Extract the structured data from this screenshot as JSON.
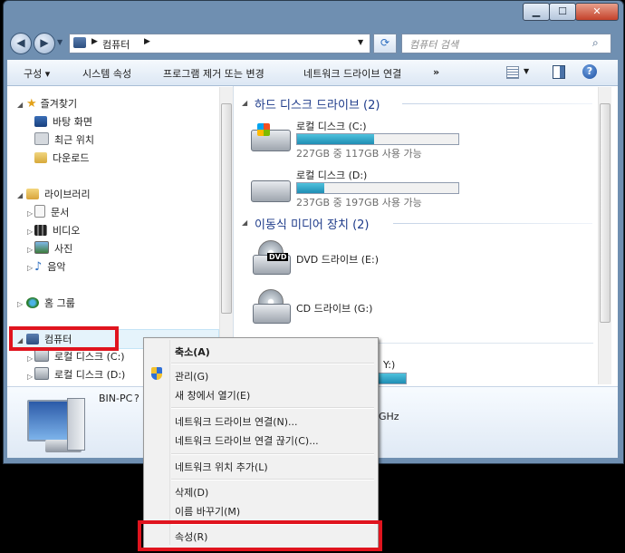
{
  "titlebar": {
    "minimize": "▁",
    "maximize": "☐",
    "close": "✕"
  },
  "nav": {
    "back_icon": "back-arrow-icon",
    "forward_icon": "forward-arrow-icon",
    "breadcrumb": "컴퓨터",
    "search_placeholder": "컴퓨터 검색"
  },
  "toolbar": {
    "organize": "구성 ▾",
    "system_properties": "시스템 속성",
    "uninstall": "프로그램 제거 또는 변경",
    "map_drive": "네트워크 드라이브 연결",
    "more": "»"
  },
  "sidebar": {
    "favorites": "즐겨찾기",
    "desktop": "바탕 화면",
    "recent": "최근 위치",
    "downloads": "다운로드",
    "libraries": "라이브러리",
    "documents": "문서",
    "videos": "비디오",
    "pictures": "사진",
    "music": "음악",
    "homegroup": "홈 그룹",
    "computer": "컴퓨터",
    "local_c": "로컬 디스크 (C:)",
    "local_d": "로컬 디스크 (D:)"
  },
  "content": {
    "hdd_group": "하드 디스크 드라이브 (2)",
    "removable_group": "이동식 미디어 장치 (2)",
    "drives": [
      {
        "name": "로컬 디스크 (C:)",
        "info": "227GB 중 117GB 사용 가능",
        "used_fraction": 0.48
      },
      {
        "name": "로컬 디스크 (D:)",
        "info": "237GB 중 197GB 사용 가능",
        "used_fraction": 0.17
      }
    ],
    "dvd": "DVD 드라이브 (E:)",
    "cd": "CD 드라이브 (G:)",
    "partial_drive": "Y:)",
    "dvd_badge": "DVD"
  },
  "details": {
    "pc_name": "BIN-PC",
    "partial_left": "?",
    "partial_right": "GHz"
  },
  "context_menu": {
    "items": [
      "축소(A)",
      "관리(G)",
      "새 창에서 열기(E)",
      "네트워크 드라이브 연결(N)...",
      "네트워크 드라이브 연결 끊기(C)...",
      "네트워크 위치 추가(L)",
      "삭제(D)",
      "이름 바꾸기(M)",
      "속성(R)"
    ]
  },
  "colors": {
    "highlight_red": "#e0141e",
    "bar_fill": "#26a0da"
  }
}
